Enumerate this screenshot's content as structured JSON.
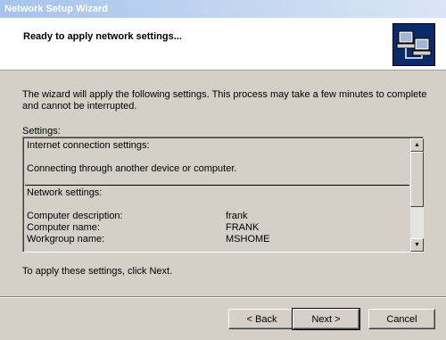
{
  "window": {
    "title": "Network Setup Wizard"
  },
  "header": {
    "title": "Ready to apply network settings...",
    "icon": "network-computers-icon"
  },
  "intro_text": "The wizard will apply the following settings. This process may take a few minutes to complete and cannot be interrupted.",
  "settings": {
    "label": "Settings:",
    "internet_heading": "Internet connection settings:",
    "internet_detail": "Connecting through another device or computer.",
    "network_heading": "Network settings:",
    "rows": [
      {
        "label": "Computer description:",
        "value": "frank"
      },
      {
        "label": "Computer name:",
        "value": "FRANK"
      },
      {
        "label": "Workgroup name:",
        "value": "MSHOME"
      }
    ]
  },
  "apply_text": "To apply these settings, click Next.",
  "buttons": {
    "back": "< Back",
    "next": "Next >",
    "cancel": "Cancel"
  },
  "colors": {
    "dialog_bg": "#d4d0c8",
    "title_gradient_start": "#a6c4ec",
    "icon_bg": "#0a2a6b"
  }
}
